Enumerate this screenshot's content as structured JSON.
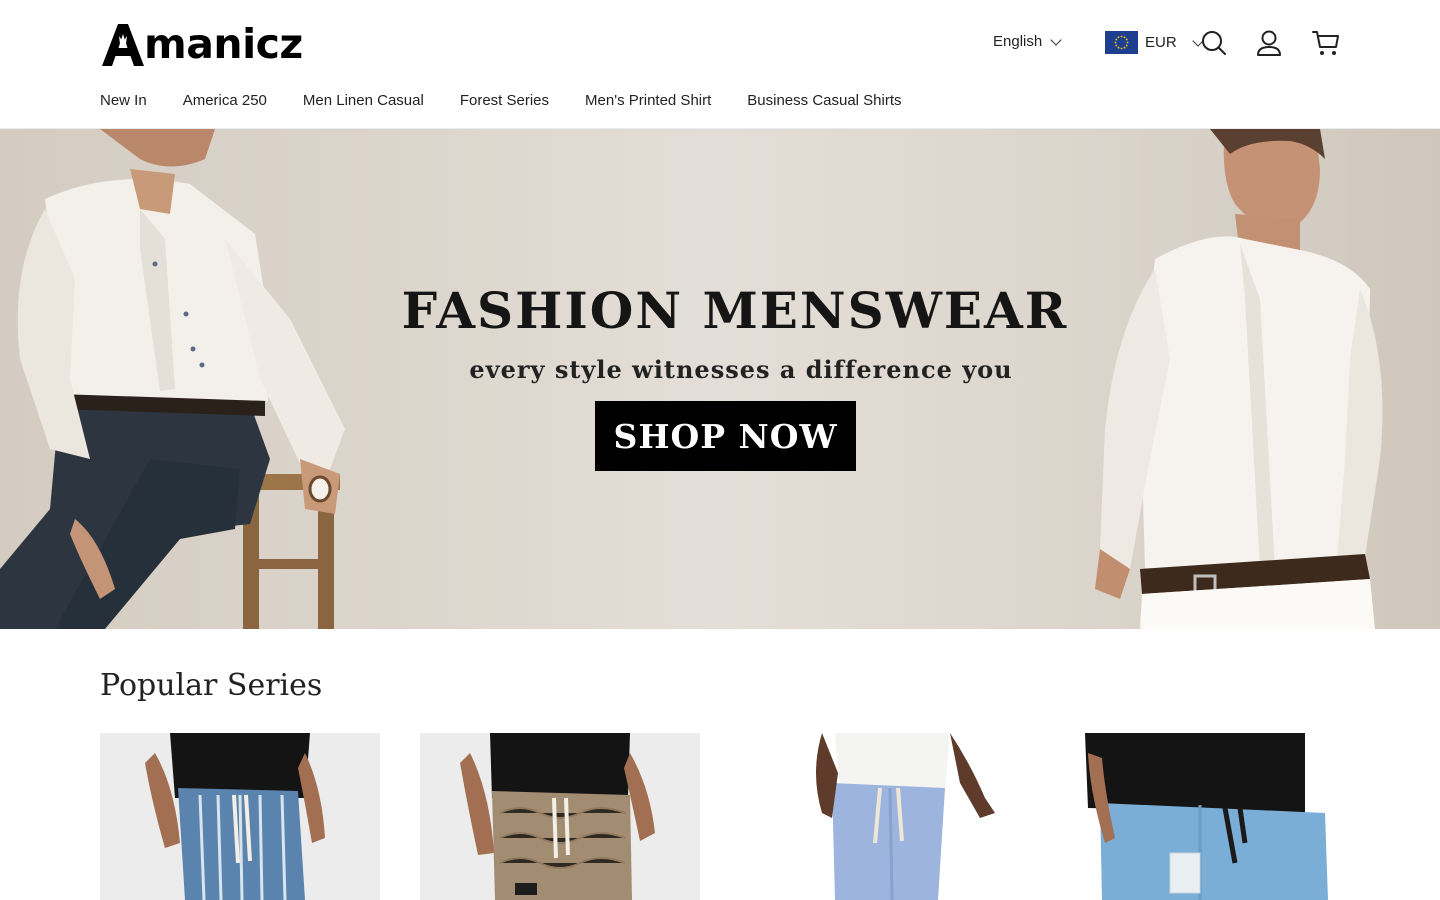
{
  "brand": {
    "name": "manicz",
    "logo_letter": "A"
  },
  "header": {
    "language": "English",
    "currency": "EUR",
    "icons": [
      "search-icon",
      "account-icon",
      "cart-icon"
    ]
  },
  "nav": {
    "items": [
      "New In",
      "America 250",
      "Men Linen Casual",
      "Forest Series",
      "Men's Printed Shirt",
      "Business Casual Shirts"
    ]
  },
  "hero": {
    "title": "FASHION MENSWEAR",
    "subtitle": "every style witnesses a difference you",
    "cta": "SHOP NOW"
  },
  "popular": {
    "title": "Popular Series"
  },
  "colors": {
    "hero_bg": "#ddd6cd",
    "cta_bg": "#000000",
    "flag_blue": "#1e3f8f",
    "flag_star": "#ffcc00"
  }
}
